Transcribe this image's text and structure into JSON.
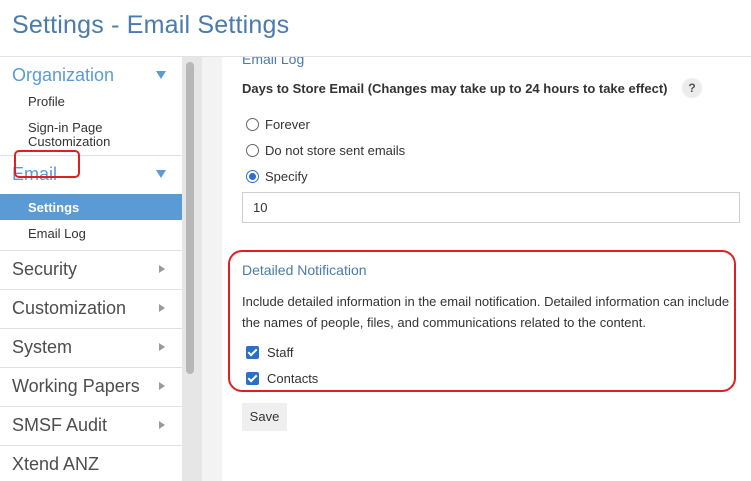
{
  "header": {
    "title": "Settings - Email Settings"
  },
  "sidebar": {
    "groups": [
      {
        "label": "Organization",
        "expanded": true,
        "items": [
          "Profile",
          "Sign-in Page Customization"
        ]
      },
      {
        "label": "Email",
        "expanded": true,
        "items": [
          "Settings",
          "Email Log"
        ],
        "selected": "Settings"
      },
      {
        "label": "Security"
      },
      {
        "label": "Customization"
      },
      {
        "label": "System"
      },
      {
        "label": "Working Papers"
      },
      {
        "label": "SMSF Audit"
      },
      {
        "label": "Xtend ANZ"
      }
    ],
    "sign_in_line1": "Sign-in Page",
    "sign_in_line2": "Customization"
  },
  "main": {
    "section_title": "Email Log",
    "days_label": "Days to Store Email (Changes may take up to 24 hours to take effect)",
    "help_label": "?",
    "radio_options": [
      "Forever",
      "Do not store sent emails",
      "Specify"
    ],
    "selected_option": "Specify",
    "days_value": "10",
    "notification": {
      "title": "Detailed Notification",
      "description": "Include detailed information in the email notification. Detailed information can include the names of people, files, and communications related to the content.",
      "checkboxes": [
        {
          "label": "Staff",
          "checked": true
        },
        {
          "label": "Contacts",
          "checked": true
        }
      ]
    },
    "save_label": "Save"
  },
  "colors": {
    "title_blue": "#4a7bab",
    "accent_blue": "#5b9bd5",
    "selection_blue": "#2b6fc9",
    "highlight_red": "#e02020"
  }
}
